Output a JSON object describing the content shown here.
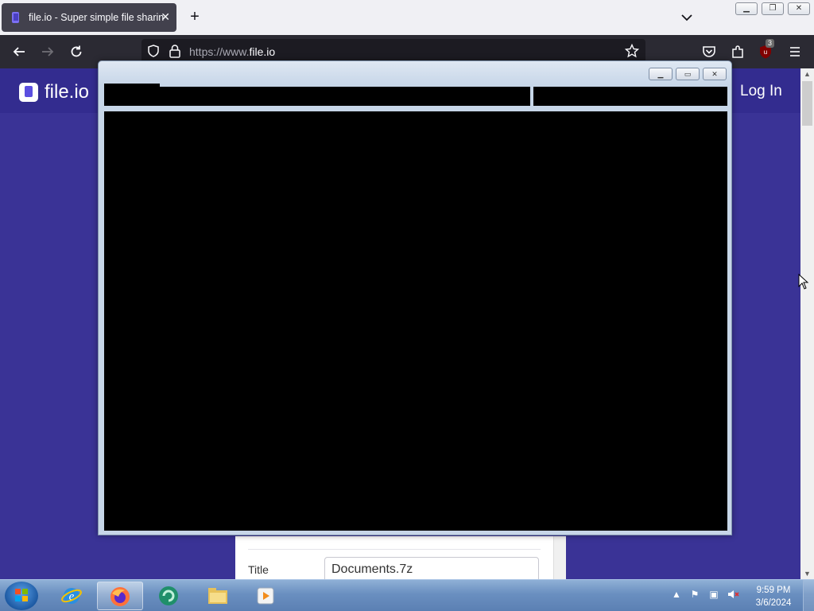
{
  "browser": {
    "tab_title": "file.io - Super simple file sharing",
    "url_prefix": "https://www.",
    "url_host": "file.io",
    "extension_badge": "3"
  },
  "site": {
    "logo_text": "file.io",
    "login_label": "Log In",
    "form": {
      "title_label": "Title",
      "title_value": "Documents.7z"
    }
  },
  "taskbar": {
    "time": "9:59 PM",
    "date": "3/6/2024"
  },
  "colors": {
    "page_bg": "#3a3396",
    "header_bg": "#332c8f",
    "browser_toolbar": "#2b2a33"
  }
}
